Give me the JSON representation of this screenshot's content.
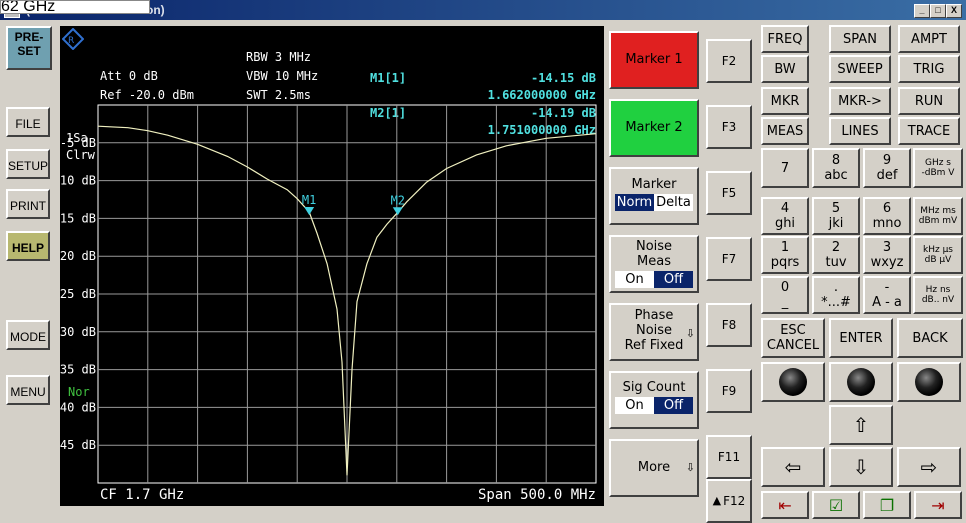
{
  "window": {
    "title": "(Front Panel Simulation)",
    "freq_box": "62 GHz",
    "controls": [
      "_",
      "□",
      "X"
    ]
  },
  "left_buttons": [
    {
      "id": "preset",
      "label_1": "PRE-",
      "label_2": "SET"
    },
    {
      "id": "file",
      "label": "FILE"
    },
    {
      "id": "setup",
      "label": "SETUP"
    },
    {
      "id": "print",
      "label": "PRINT"
    },
    {
      "id": "help",
      "label": "HELP"
    },
    {
      "id": "mode",
      "label": "MODE"
    },
    {
      "id": "menu",
      "label": "MENU"
    }
  ],
  "screen": {
    "att": "Att  0 dB",
    "ref": "Ref  -20.0 dBm",
    "rbw": "RBW 3 MHz",
    "vbw": "VBW 10 MHz",
    "swt": "SWT 2.5ms",
    "m1_label": "M1[1]",
    "m1_level": "-14.15 dB",
    "m1_freq": "1.662000000 GHz",
    "m2_label": "M2[1]",
    "m2_level": "-14.19 dB",
    "m2_freq": "1.751000000 GHz",
    "trace_mode_1": "1Sa",
    "trace_mode_2": "Clrw",
    "nor": "Nor",
    "cf": "CF 1.7 GHz",
    "span": "Span 500.0 MHz",
    "y_ticks": [
      "-5 dB",
      "-10 dB",
      "-15 dB",
      "-20 dB",
      "-25 dB",
      "-30 dB",
      "-35 dB",
      "-40 dB",
      "-45 dB"
    ],
    "marker_1_name": "M1",
    "marker_2_name": "M2"
  },
  "chart_data": {
    "type": "line",
    "x_range_ghz": [
      1.45,
      1.95
    ],
    "ylim": [
      -50,
      0
    ],
    "grid": true,
    "series": [
      {
        "x": [
          1.45,
          1.48,
          1.5,
          1.52,
          1.55,
          1.58,
          1.6,
          1.62,
          1.64,
          1.65,
          1.662,
          1.67,
          1.68,
          1.69,
          1.695,
          1.7,
          1.705,
          1.71,
          1.72,
          1.73,
          1.74,
          1.751,
          1.76,
          1.78,
          1.8,
          1.83,
          1.86,
          1.9,
          1.95
        ],
        "y": [
          -2.8,
          -3.0,
          -3.4,
          -4.0,
          -5.2,
          -6.8,
          -8.2,
          -9.8,
          -11.2,
          -12.4,
          -14.15,
          -17,
          -21,
          -27,
          -34,
          -49,
          -35,
          -26,
          -21,
          -17.5,
          -15.8,
          -14.19,
          -12.8,
          -10.2,
          -8.4,
          -6.6,
          -5.4,
          -4.4,
          -3.8
        ]
      }
    ],
    "markers": [
      {
        "name": "M1",
        "x": 1.662,
        "y": -14.15
      },
      {
        "name": "M2",
        "x": 1.751,
        "y": -14.19
      }
    ]
  },
  "softkeys": {
    "marker1": "Marker 1",
    "marker2": "Marker 2",
    "marker": "Marker",
    "norm": "Norm",
    "delta": "Delta",
    "noise_1": "Noise",
    "noise_2": "Meas",
    "on": "On",
    "off": "Off",
    "phase_1": "Phase",
    "phase_2": "Noise",
    "phase_3": "Ref Fixed",
    "sig": "Sig Count",
    "more": "More",
    "more_arrow": "⇩"
  },
  "colors": {
    "marker1_bg": "#e02020",
    "marker2_bg": "#20d040",
    "trace": "#f0f0c0",
    "marker_tri": "#40d0e0"
  },
  "fkeys": [
    "F2",
    "F3",
    "F5",
    "F7",
    "F8",
    "F9",
    "F11",
    "F12"
  ],
  "keypad": {
    "row1": [
      "FREQ",
      "SPAN",
      "AMPT"
    ],
    "row2": [
      "BW",
      "SWEEP",
      "TRIG"
    ],
    "row3": [
      "MKR",
      "MKR->",
      "RUN"
    ],
    "row4": [
      "MEAS",
      "LINES",
      "TRACE"
    ],
    "digits": [
      {
        "d": "7",
        "s": ""
      },
      {
        "d": "8",
        "s": "abc"
      },
      {
        "d": "9",
        "s": "def"
      },
      {
        "d": "4",
        "s": "ghi"
      },
      {
        "d": "5",
        "s": "jki"
      },
      {
        "d": "6",
        "s": "mno"
      },
      {
        "d": "1",
        "s": "pqrs"
      },
      {
        "d": "2",
        "s": "tuv"
      },
      {
        "d": "3",
        "s": "wxyz"
      },
      {
        "d": "0",
        "s": "_"
      },
      {
        "d": ".",
        "s": "*...#"
      },
      {
        "d": "-",
        "s": "A - a"
      }
    ],
    "units": [
      {
        "a": "GHz  s",
        "b": "-dBm  V"
      },
      {
        "a": "MHz ms",
        "b": "dBm mV"
      },
      {
        "a": "kHz   µs",
        "b": "dB   µV"
      },
      {
        "a": "Hz   ns",
        "b": "dB..  nV"
      }
    ],
    "esc_1": "ESC",
    "esc_2": "CANCEL",
    "enter": "ENTER",
    "back": "BACK"
  }
}
